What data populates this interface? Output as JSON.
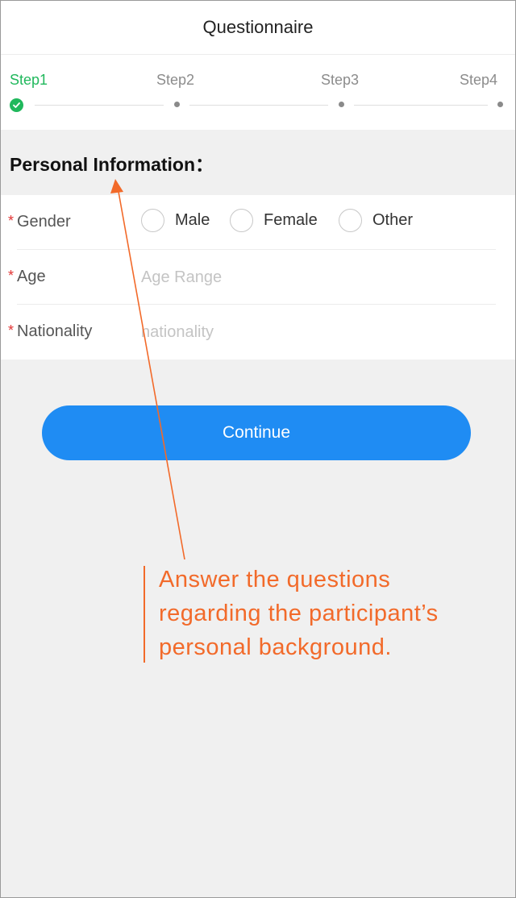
{
  "header": {
    "title": "Questionnaire"
  },
  "steps": {
    "items": [
      {
        "label": "Step1",
        "state": "completed"
      },
      {
        "label": "Step2",
        "state": "pending"
      },
      {
        "label": "Step3",
        "state": "pending"
      },
      {
        "label": "Step4",
        "state": "pending"
      }
    ]
  },
  "section": {
    "title": "Personal Information："
  },
  "form": {
    "required_marker": "*",
    "gender": {
      "label": "Gender",
      "options": [
        "Male",
        "Female",
        "Other"
      ]
    },
    "age": {
      "label": "Age",
      "placeholder": "Age Range",
      "value": ""
    },
    "nationality": {
      "label": "Nationality",
      "placeholder": "nationality",
      "value": ""
    }
  },
  "actions": {
    "continue_label": "Continue"
  },
  "annotation": {
    "lines": [
      "Answer the questions",
      "regarding the participant’s",
      "personal background."
    ]
  },
  "colors": {
    "accent_blue": "#1f8cf3",
    "success_green": "#20b85c",
    "required_red": "#e23434",
    "annotation_orange": "#f26a2a"
  }
}
